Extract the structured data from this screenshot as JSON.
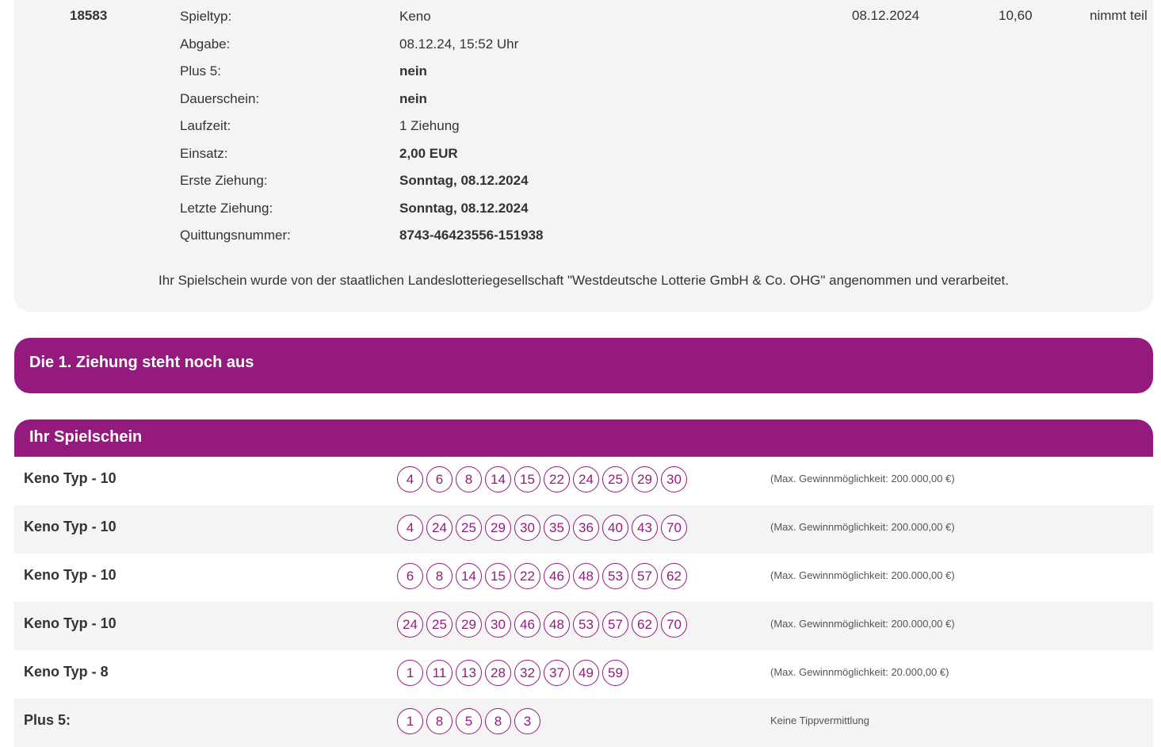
{
  "ticket": {
    "id": "18583",
    "date": "08.12.2024",
    "amount": "10,60",
    "status": "nimmt teil",
    "details": [
      {
        "label": "Spieltyp:",
        "value": "Keno"
      },
      {
        "label": "Abgabe:",
        "value": "08.12.24, 15:52 Uhr"
      },
      {
        "label": "Plus 5:",
        "value": "nein"
      },
      {
        "label": "Dauerschein:",
        "value": "nein"
      },
      {
        "label": "Laufzeit:",
        "value": "1 Ziehung"
      },
      {
        "label": "Einsatz:",
        "value": "2,00 EUR"
      },
      {
        "label": "Erste Ziehung:",
        "value": "Sonntag, 08.12.2024"
      },
      {
        "label": "Letzte Ziehung:",
        "value": "Sonntag, 08.12.2024"
      },
      {
        "label": "Quittungsnummer:",
        "value": "8743-46423556-151938"
      }
    ],
    "notice": "Ihr Spielschein wurde von der staatlichen Landeslotteriegesellschaft \"Westdeutsche Lotterie GmbH & Co. OHG\" angenommen und verarbeitet."
  },
  "draw_banner": {
    "text": "Die 1. Ziehung steht noch aus"
  },
  "slip": {
    "title": "Ihr Spielschein",
    "rows": [
      {
        "label": "Keno Typ - 10",
        "numbers": [
          "4",
          "6",
          "8",
          "14",
          "15",
          "22",
          "24",
          "25",
          "29",
          "30"
        ],
        "note": "(Max. Gewinnmöglichkeit: 200.000,00 €)"
      },
      {
        "label": "Keno Typ - 10",
        "numbers": [
          "4",
          "24",
          "25",
          "29",
          "30",
          "35",
          "36",
          "40",
          "43",
          "70"
        ],
        "note": "(Max. Gewinnmöglichkeit: 200.000,00 €)"
      },
      {
        "label": "Keno Typ - 10",
        "numbers": [
          "6",
          "8",
          "14",
          "15",
          "22",
          "46",
          "48",
          "53",
          "57",
          "62"
        ],
        "note": "(Max. Gewinnmöglichkeit: 200.000,00 €)"
      },
      {
        "label": "Keno Typ - 10",
        "numbers": [
          "24",
          "25",
          "29",
          "30",
          "46",
          "48",
          "53",
          "57",
          "62",
          "70"
        ],
        "note": "(Max. Gewinnmöglichkeit: 200.000,00 €)"
      },
      {
        "label": "Keno Typ - 8",
        "numbers": [
          "1",
          "11",
          "13",
          "28",
          "32",
          "37",
          "49",
          "59"
        ],
        "note": "(Max. Gewinnmöglichkeit: 20.000,00 €)"
      },
      {
        "label": "Plus 5:",
        "numbers": [
          "1",
          "8",
          "5",
          "8",
          "3"
        ],
        "note": "Keine Tippvermittlung"
      }
    ]
  },
  "colors": {
    "accent": "#941a7e",
    "card_bg": "#f4f4f4"
  }
}
